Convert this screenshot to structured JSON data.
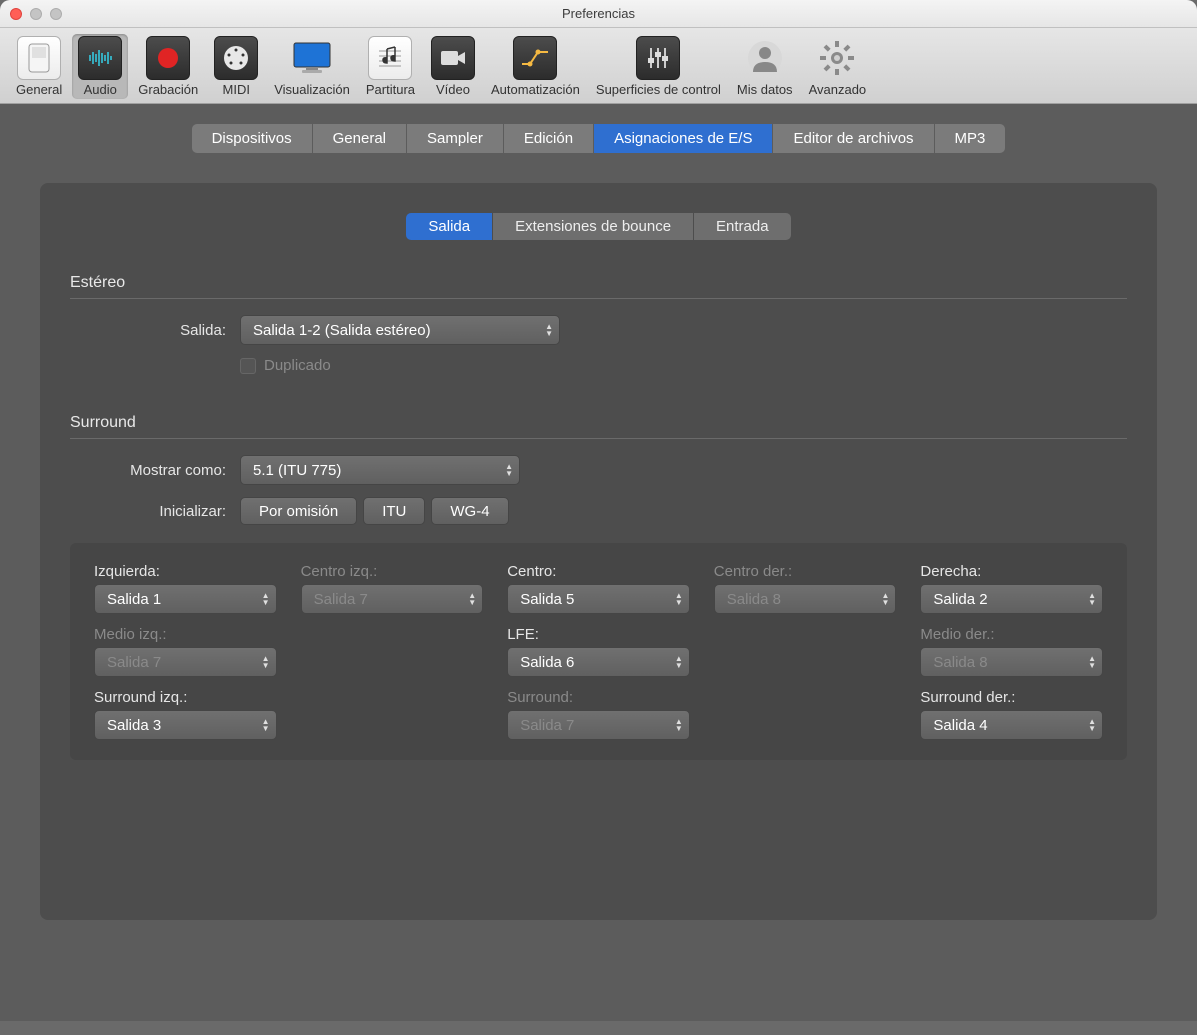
{
  "window": {
    "title": "Preferencias"
  },
  "toolbar": {
    "items": [
      {
        "id": "general",
        "label": "General"
      },
      {
        "id": "audio",
        "label": "Audio",
        "selected": true
      },
      {
        "id": "grabacion",
        "label": "Grabación"
      },
      {
        "id": "midi",
        "label": "MIDI"
      },
      {
        "id": "visualizacion",
        "label": "Visualización"
      },
      {
        "id": "partitura",
        "label": "Partitura"
      },
      {
        "id": "video",
        "label": "Vídeo"
      },
      {
        "id": "automatizacion",
        "label": "Automatización"
      },
      {
        "id": "superficies",
        "label": "Superficies de control"
      },
      {
        "id": "misdatos",
        "label": "Mis datos"
      },
      {
        "id": "avanzado",
        "label": "Avanzado"
      }
    ]
  },
  "tabs_primary": [
    {
      "label": "Dispositivos"
    },
    {
      "label": "General"
    },
    {
      "label": "Sampler"
    },
    {
      "label": "Edición"
    },
    {
      "label": "Asignaciones de E/S",
      "active": true
    },
    {
      "label": "Editor de archivos"
    },
    {
      "label": "MP3"
    }
  ],
  "tabs_secondary": [
    {
      "label": "Salida",
      "active": true
    },
    {
      "label": "Extensiones de bounce"
    },
    {
      "label": "Entrada"
    }
  ],
  "stereo": {
    "title": "Estéreo",
    "output_label": "Salida:",
    "output_value": "Salida 1-2 (Salida estéreo)",
    "mirror_label": "Duplicado"
  },
  "surround": {
    "title": "Surround",
    "show_as_label": "Mostrar como:",
    "show_as_value": "5.1 (ITU 775)",
    "init_label": "Inicializar:",
    "init_buttons": [
      "Por omisión",
      "ITU",
      "WG-4"
    ],
    "cells": {
      "left": {
        "label": "Izquierda:",
        "value": "Salida 1",
        "enabled": true
      },
      "center_left": {
        "label": "Centro izq.:",
        "value": "Salida 7",
        "enabled": false
      },
      "center": {
        "label": "Centro:",
        "value": "Salida 5",
        "enabled": true
      },
      "center_right": {
        "label": "Centro der.:",
        "value": "Salida 8",
        "enabled": false
      },
      "right": {
        "label": "Derecha:",
        "value": "Salida 2",
        "enabled": true
      },
      "mid_left": {
        "label": "Medio izq.:",
        "value": "Salida 7",
        "enabled": false
      },
      "lfe": {
        "label": "LFE:",
        "value": "Salida 6",
        "enabled": true
      },
      "mid_right": {
        "label": "Medio der.:",
        "value": "Salida 8",
        "enabled": false
      },
      "surr_left": {
        "label": "Surround izq.:",
        "value": "Salida 3",
        "enabled": true
      },
      "surr_center": {
        "label": "Surround:",
        "value": "Salida 7",
        "enabled": false
      },
      "surr_right": {
        "label": "Surround der.:",
        "value": "Salida 4",
        "enabled": true
      }
    }
  }
}
